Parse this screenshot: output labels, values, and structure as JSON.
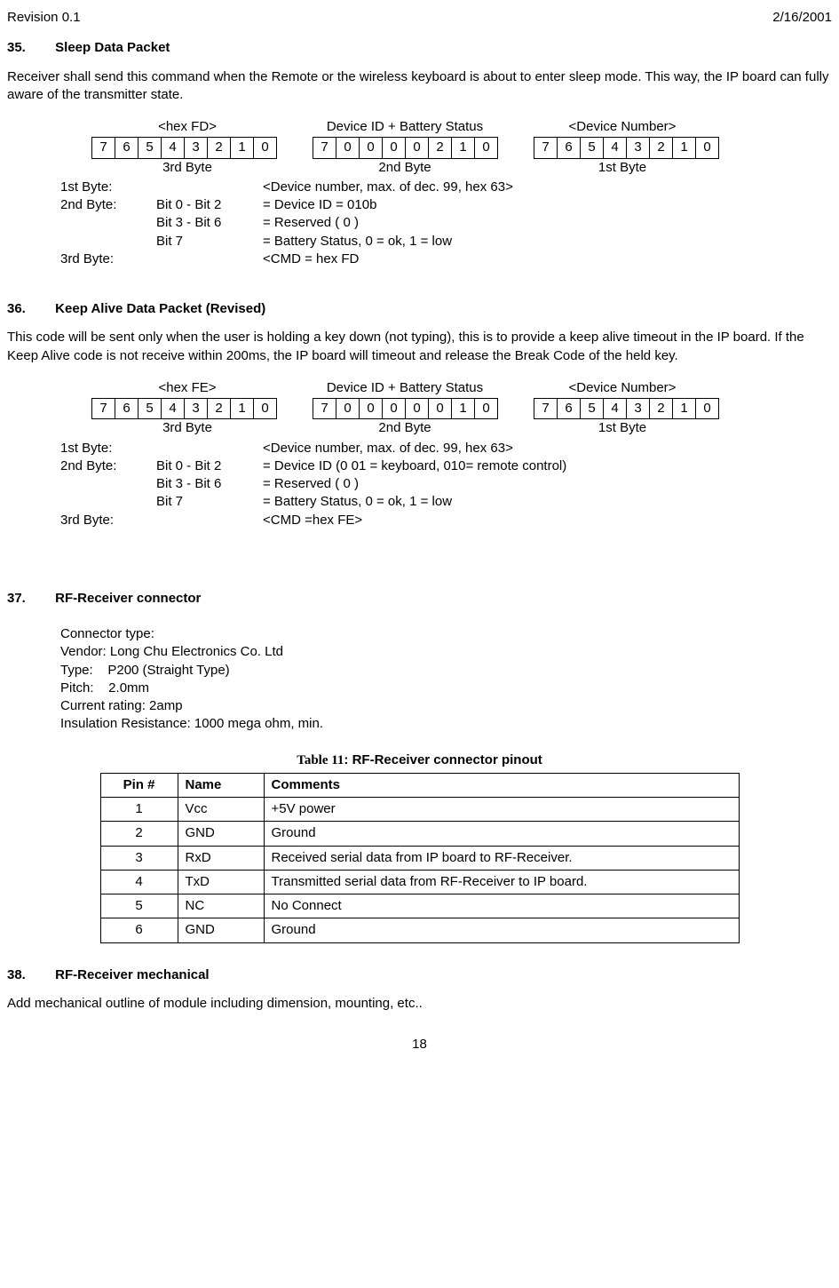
{
  "header": {
    "left": "Revision 0.1",
    "right": "2/16/2001"
  },
  "s35": {
    "num": "35.",
    "title": "Sleep Data Packet",
    "para": "Receiver shall send this command when the Remote or the wireless keyboard is about to enter sleep mode. This way, the IP board can fully aware of the transmitter state.",
    "labels": {
      "b3": "<hex FD>",
      "b2": "Device ID + Battery Status",
      "b1": "<Device Number>"
    },
    "bits": {
      "b3": [
        "7",
        "6",
        "5",
        "4",
        "3",
        "2",
        "1",
        "0"
      ],
      "b2": [
        "7",
        "0",
        "0",
        "0",
        "0",
        "2",
        "1",
        "0"
      ],
      "b1": [
        "7",
        "6",
        "5",
        "4",
        "3",
        "2",
        "1",
        "0"
      ]
    },
    "captions": {
      "b3": "3rd Byte",
      "b2": "2nd Byte",
      "b1": "1st Byte"
    },
    "defs": [
      {
        "c1": "1st Byte:",
        "c2": "",
        "c3": "<Device number, max. of dec. 99, hex 63>"
      },
      {
        "c1": "2nd Byte:",
        "c2": "Bit 0 - Bit 2",
        "c3": "= Device ID = 010b"
      },
      {
        "c1": "",
        "c2": "Bit 3 - Bit 6",
        "c3": "= Reserved ( 0 )"
      },
      {
        "c1": "",
        "c2": "Bit 7",
        "c3": "= Battery Status, 0 = ok, 1 = low"
      },
      {
        "c1": "3rd Byte:",
        "c2": "",
        "c3": "<CMD = hex FD"
      }
    ]
  },
  "s36": {
    "num": "36.",
    "title": "Keep Alive Data Packet (Revised)",
    "para": "This code will be sent only when the user is holding a key down (not typing), this is to provide a keep alive timeout in the IP board. If the Keep Alive code is not receive within 200ms, the IP board will timeout and release the Break Code  of the held key.",
    "labels": {
      "b3": "<hex FE>",
      "b2": "Device ID + Battery Status",
      "b1": "<Device Number>"
    },
    "bits": {
      "b3": [
        "7",
        "6",
        "5",
        "4",
        "3",
        "2",
        "1",
        "0"
      ],
      "b2": [
        "7",
        "0",
        "0",
        "0",
        "0",
        "0",
        "1",
        "0"
      ],
      "b1": [
        "7",
        "6",
        "5",
        "4",
        "3",
        "2",
        "1",
        "0"
      ]
    },
    "captions": {
      "b3": "3rd Byte",
      "b2": "2nd Byte",
      "b1": "1st Byte"
    },
    "defs": [
      {
        "c1": "1st Byte:",
        "c2": "",
        "c3": "<Device number, max. of dec. 99, hex 63>"
      },
      {
        "c1": "2nd Byte:",
        "c2": "Bit 0 - Bit 2",
        "c3": "= Device ID (0 01 = keyboard, 010= remote control)"
      },
      {
        "c1": "",
        "c2": "Bit 3 - Bit 6",
        "c3": "= Reserved ( 0 )"
      },
      {
        "c1": "",
        "c2": "Bit 7",
        "c3": "= Battery Status, 0 = ok, 1 = low"
      },
      {
        "c1": "3rd Byte:",
        "c2": "",
        "c3": "<CMD =hex FE>"
      }
    ]
  },
  "s37": {
    "num": "37.",
    "title": " RF-Receiver connector",
    "lines": [
      "Connector type:",
      "Vendor: Long Chu Electronics Co. Ltd",
      "Type:    P200 (Straight Type)",
      "Pitch:    2.0mm",
      "Current rating:   2amp",
      "Insulation Resistance: 1000 mega ohm, min."
    ],
    "table_caption_prefix": "Table 11",
    "table_caption_rest": ": RF-Receiver connector pinout",
    "table_headers": [
      "Pin #",
      "Name",
      "Comments"
    ],
    "table_rows": [
      [
        "1",
        "Vcc",
        "+5V power"
      ],
      [
        "2",
        "GND",
        "Ground"
      ],
      [
        "3",
        "RxD",
        "Received serial data from IP board to RF-Receiver."
      ],
      [
        "4",
        "TxD",
        "Transmitted serial data from RF-Receiver to IP board."
      ],
      [
        "5",
        "NC",
        "No Connect"
      ],
      [
        "6",
        "GND",
        "Ground"
      ]
    ]
  },
  "s38": {
    "num": "38.",
    "title": "RF-Receiver mechanical",
    "para": "Add mechanical outline of module including dimension, mounting, etc.."
  },
  "footer": {
    "page": "18"
  }
}
